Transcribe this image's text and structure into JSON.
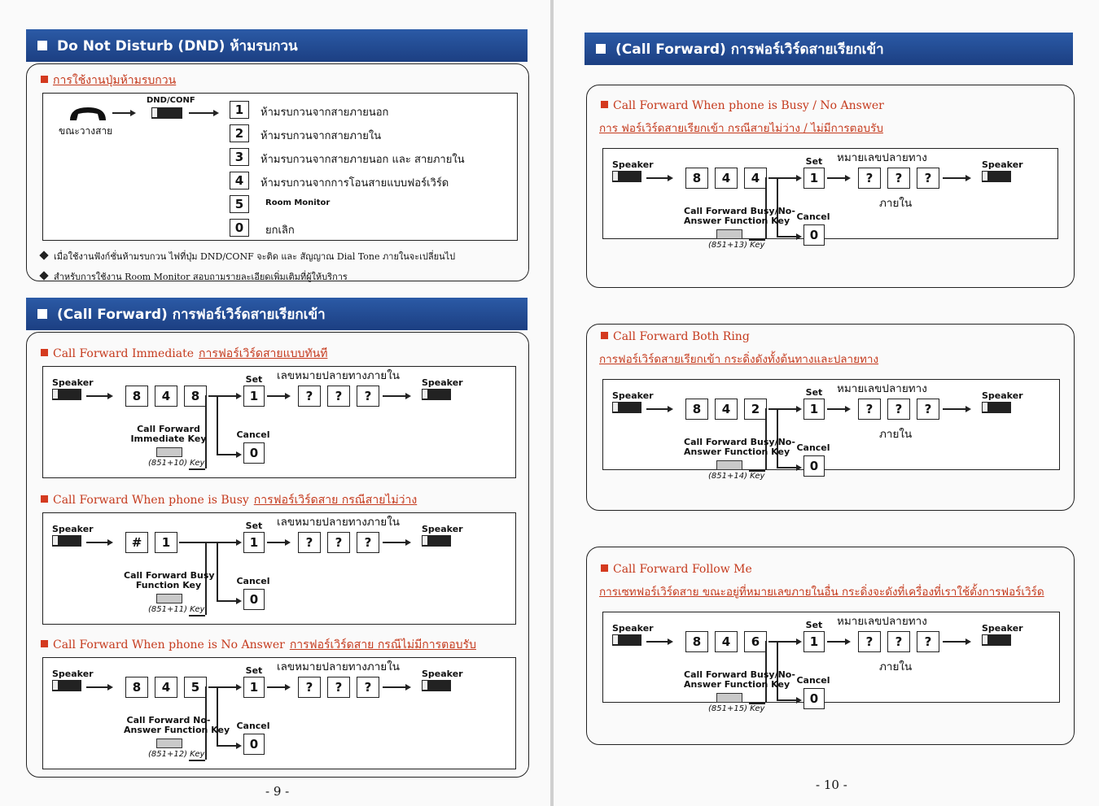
{
  "left": {
    "dnd": {
      "title": "Do Not Disturb (DND) ห้ามรบกวน",
      "usage": "การใช้งานปุ่มห้ามรบกวน",
      "handset_label": "ขณะวางสาย",
      "key_label": "DND/CONF",
      "options": [
        {
          "key": "1",
          "text": "ห้ามรบกวนจากสายภายนอก"
        },
        {
          "key": "2",
          "text": "ห้ามรบกวนจากสายภายใน"
        },
        {
          "key": "3",
          "text": "ห้ามรบกวนจากสายภายนอก และ สายภายใน"
        },
        {
          "key": "4",
          "text": "ห้ามรบกวนจากการโอนสายแบบฟอร์เวิร์ด"
        },
        {
          "key": "5",
          "text": "Room Monitor"
        },
        {
          "key": "0",
          "text": "ยกเลิก"
        }
      ],
      "notes": [
        "เมื่อใช้งานฟังก์ชั่นห้ามรบกวน ไฟที่ปุ่ม DND/CONF จะติด และ สัญญาณ Dial Tone ภายในจะเปลี่ยนไป",
        "สำหรับการใช้งาน Room Monitor สอบถามรายละเอียดเพิ่มเติมที่ผู้ให้บริการ"
      ]
    },
    "cf_title": "(Call Forward) การฟอร์เวิร์ดสายเรียกเข้า",
    "sections": [
      {
        "title": "Call Forward Immediate",
        "thai": "การฟอร์เวิร์ดสายแบบทันที",
        "codes": [
          "8",
          "4",
          "8"
        ],
        "func": "Call Forward\nImmediate Key",
        "ref": "(851+10) Key",
        "dest": "เลขหมายปลายทางภายใน"
      },
      {
        "title": "Call Forward When phone is Busy",
        "thai": "การฟอร์เวิร์ดสาย กรณีสายไม่ว่าง",
        "codes": [
          "#",
          "1"
        ],
        "func": "Call Forward Busy\nFunction Key",
        "ref": "(851+11) Key",
        "dest": "เลขหมายปลายทางภายใน"
      },
      {
        "title": "Call Forward When phone is No Answer",
        "thai": "การฟอร์เวิร์ดสาย กรณีไม่มีการตอบรับ",
        "codes": [
          "8",
          "4",
          "5"
        ],
        "func": "Call Forward No-\nAnswer Function Key",
        "ref": "(851+12) Key",
        "dest": "เลขหมายปลายทางภายใน"
      }
    ],
    "page_number": "- 9 -"
  },
  "right": {
    "cf_title": "(Call Forward) การฟอร์เวิร์ดสายเรียกเข้า",
    "sections": [
      {
        "title": "Call Forward When phone is Busy / No Answer",
        "thai": "การ ฟอร์เวิร์ดสายเรียกเข้า กรณีสายไม่ว่าง / ไม่มีการตอบรับ",
        "codes": [
          "8",
          "4",
          "4"
        ],
        "func": "Call Forward Busy/No-\nAnswer Function Key",
        "ref": "(851+13) Key",
        "dest": "หมายเลขปลายทาง",
        "dest2": "ภายใน"
      },
      {
        "title": "Call Forward Both Ring",
        "thai": "การฟอร์เวิร์ดสายเรียกเข้า กระดิ่งดังทั้งต้นทางและปลายทาง",
        "codes": [
          "8",
          "4",
          "2"
        ],
        "func": "Call Forward Busy/No-\nAnswer Function Key",
        "ref": "(851+14) Key",
        "dest": "หมายเลขปลายทาง",
        "dest2": "ภายใน"
      },
      {
        "title": "Call Forward Follow Me",
        "thai": "การเซทฟอร์เวิร์ดสาย ขณะอยู่ที่หมายเลขภายในอื่น กระดิ่งจะดังที่เครื่องที่เราใช้ตั้งการฟอร์เวิร์ด",
        "codes": [
          "8",
          "4",
          "6"
        ],
        "func": "Call Forward Busy/No-\nAnswer Function Key",
        "ref": "(851+15) Key",
        "dest": "หมายเลขปลายทาง",
        "dest2": "ภายใน"
      }
    ],
    "page_number": "- 10 -"
  },
  "common": {
    "speaker": "Speaker",
    "set": "Set",
    "cancel": "Cancel",
    "set_key": "1",
    "cancel_key": "0",
    "unknown": "?"
  }
}
